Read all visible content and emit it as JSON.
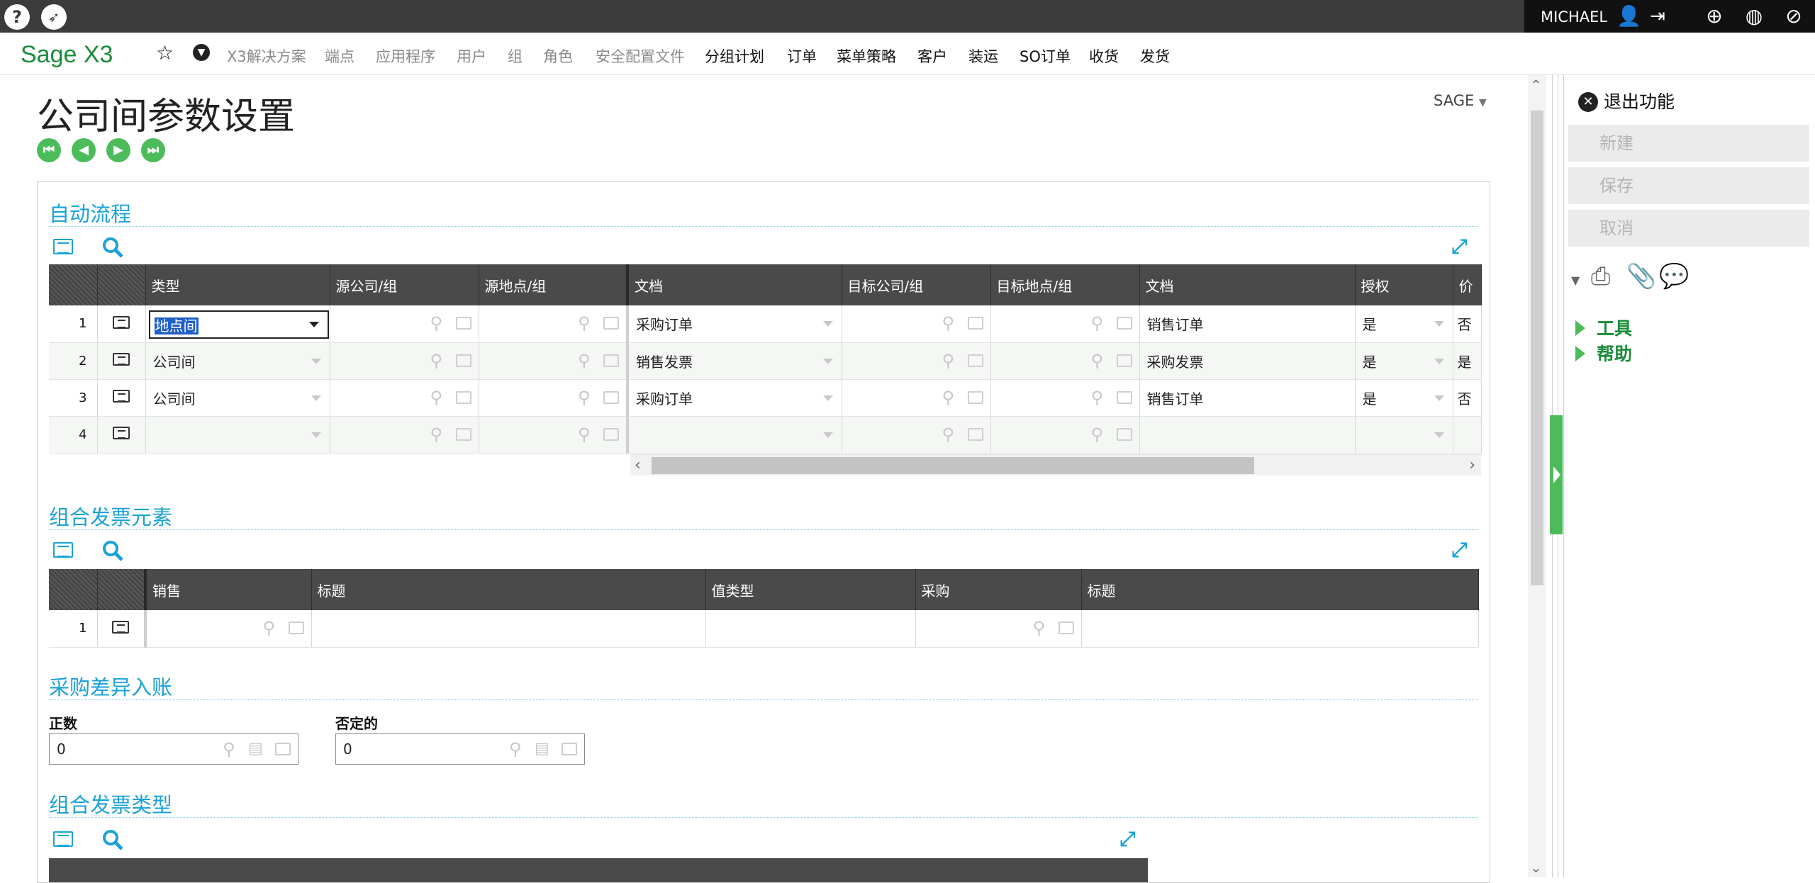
{
  "topbar": {
    "left_icons": [
      "help-icon",
      "rocket-icon"
    ],
    "user": "MICHAEL",
    "right_icons": [
      "user-icon",
      "logout-icon",
      "crosshair-icon",
      "globe-icon",
      "block-icon"
    ]
  },
  "menu": {
    "logo": "Sage X3",
    "items": [
      {
        "label": "X3解决方案",
        "style": "gray"
      },
      {
        "label": "端点",
        "style": "gray"
      },
      {
        "label": "应用程序",
        "style": "gray"
      },
      {
        "label": "用户",
        "style": "gray"
      },
      {
        "label": "组",
        "style": "gray"
      },
      {
        "label": "角色",
        "style": "gray"
      },
      {
        "label": "安全配置文件",
        "style": "gray"
      },
      {
        "label": "分组计划",
        "style": "dark"
      },
      {
        "label": "订单",
        "style": "dark"
      },
      {
        "label": "菜单策略",
        "style": "dark"
      },
      {
        "label": "客户",
        "style": "dark"
      },
      {
        "label": "装运",
        "style": "dark"
      },
      {
        "label": "SO订单",
        "style": "dark"
      },
      {
        "label": "收货",
        "style": "dark"
      },
      {
        "label": "发货",
        "style": "dark"
      }
    ]
  },
  "page": {
    "title": "公司间参数设置",
    "folder": "SAGE"
  },
  "section1": {
    "title": "自动流程",
    "columns": [
      "类型",
      "源公司/组",
      "源地点/组",
      "文档",
      "目标公司/组",
      "目标地点/组",
      "文档",
      "授权",
      "价"
    ],
    "rows": [
      {
        "n": "1",
        "type": "地点间",
        "doc1": "采购订单",
        "doc2": "销售订单",
        "auth": "是",
        "price": "否"
      },
      {
        "n": "2",
        "type": "公司间",
        "doc1": "销售发票",
        "doc2": "采购发票",
        "auth": "是",
        "price": "是"
      },
      {
        "n": "3",
        "type": "公司间",
        "doc1": "采购订单",
        "doc2": "销售订单",
        "auth": "是",
        "price": "否"
      },
      {
        "n": "4",
        "type": "",
        "doc1": "",
        "doc2": "",
        "auth": "",
        "price": ""
      }
    ]
  },
  "section2": {
    "title": "组合发票元素",
    "columns": [
      "销售",
      "标题",
      "值类型",
      "采购",
      "标题"
    ],
    "rows": [
      {
        "n": "1"
      }
    ]
  },
  "section3": {
    "title": "采购差异入账",
    "positive_label": "正数",
    "positive_value": "0",
    "negative_label": "否定的",
    "negative_value": "0"
  },
  "section4": {
    "title": "组合发票类型"
  },
  "rightpanel": {
    "exit": "退出功能",
    "buttons": [
      "新建",
      "保存",
      "取消"
    ],
    "links": [
      "工具",
      "帮助"
    ]
  }
}
